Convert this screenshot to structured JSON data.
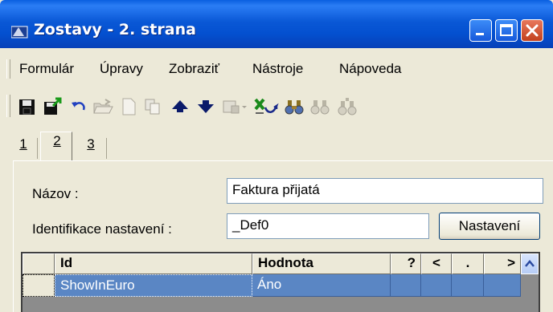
{
  "window": {
    "title": "Zostavy - 2. strana"
  },
  "menu": {
    "items": [
      "Formulár",
      "Úpravy",
      "Zobraziť",
      "Nástroje",
      "Nápoveda"
    ]
  },
  "toolbar": {
    "icons": [
      "save-icon",
      "save-as-icon",
      "undo-icon",
      "open-folder-icon",
      "new-document-icon",
      "copy-icon",
      "arrow-up-icon",
      "arrow-down-icon",
      "form-icon",
      "excel-export-icon",
      "binoculars-icon",
      "binoculars-next-icon",
      "binoculars-prev-icon"
    ]
  },
  "tabs": [
    "1",
    "2",
    "3"
  ],
  "form": {
    "name_label": "Názov  :",
    "name_value": "Faktura přijatá",
    "ident_label": "Identifikace nastavení :",
    "ident_value": "_Def0",
    "settings_button": "Nastavení"
  },
  "grid": {
    "columns": [
      "Id",
      "Hodnota",
      "?",
      "<",
      ".",
      ">"
    ],
    "rows": [
      {
        "id": "ShowInEuro",
        "value": "Áno"
      }
    ]
  }
}
